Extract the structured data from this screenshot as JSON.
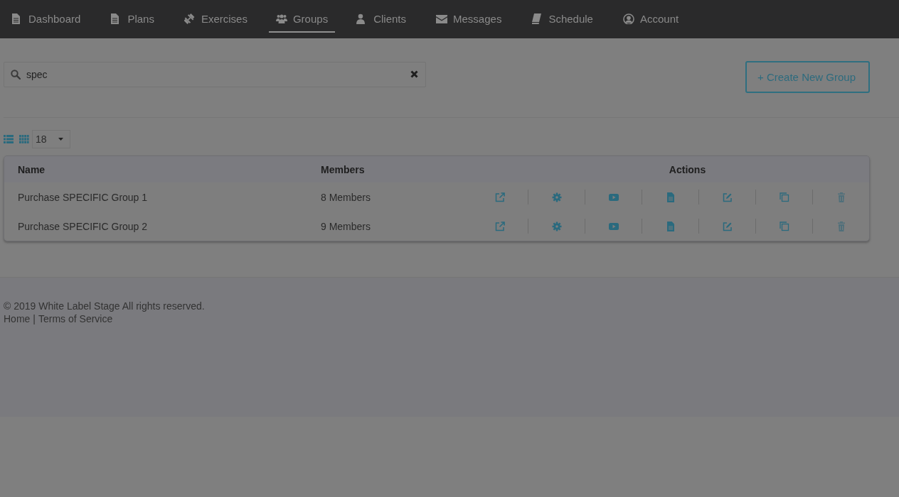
{
  "nav": {
    "tabs": [
      {
        "label": "Dashboard",
        "selected": false
      },
      {
        "label": "Plans",
        "selected": false
      },
      {
        "label": "Exercises",
        "selected": false
      },
      {
        "label": "Groups",
        "selected": true
      },
      {
        "label": "Clients",
        "selected": false
      },
      {
        "label": "Messages",
        "selected": false
      },
      {
        "label": "Schedule",
        "selected": false
      },
      {
        "label": "Account",
        "selected": false
      }
    ]
  },
  "search": {
    "value": "spec"
  },
  "create_button": {
    "label": "Create New Group",
    "icon": "+"
  },
  "page_size": "18",
  "table": {
    "columns": [
      "Name",
      "Members",
      "Actions"
    ],
    "rows": [
      {
        "name": "Purchase SPECIFIC Group 1",
        "members": "8 Members"
      },
      {
        "name": "Purchase SPECIFIC Group 2",
        "members": "9 Members"
      }
    ]
  },
  "footer": {
    "copyright": "© 2019 White Label Stage All rights reserved.",
    "links": [
      "Home",
      "|",
      "Terms of Service"
    ]
  }
}
